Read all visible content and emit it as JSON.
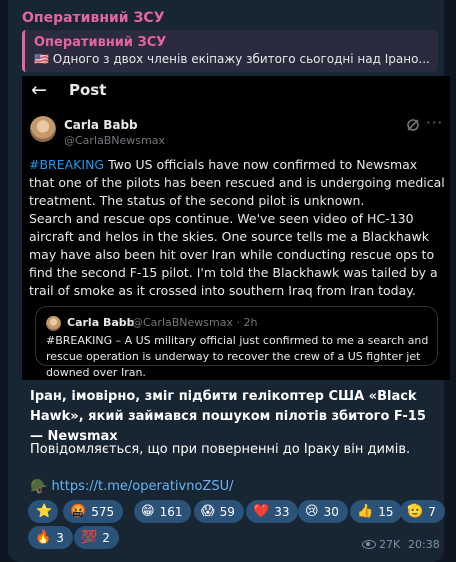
{
  "channel": {
    "name": "Оперативний ЗСУ"
  },
  "reply": {
    "title": "Оперативний ЗСУ",
    "flag": "🇺🇸",
    "text": "Одного з двох членів екіпажу збитого сьогодні над Ірано..."
  },
  "embedded_post": {
    "back_glyph": "←",
    "header": "Post",
    "author_name": "Carla Babb",
    "author_handle": "@CarlaBNewsmax",
    "more_glyph": "···",
    "hashtag": "#BREAKING",
    "text_after_hashtag": " Two US officials have now confirmed to Newsmax that one of the pilots has been rescued and is undergoing medical treatment. The status of the second pilot is unknown.",
    "text_paragraph_2": "Search and rescue ops continue. We've seen video of HC-130 aircraft and helos in the skies. One source tells me a Blackhawk may have also been hit over Iran while conducting rescue ops to find the second F-15 pilot. I'm told the Blackhawk was tailed by a trail of smoke as it crossed into southern Iraq from Iran today.",
    "quote": {
      "author_name": "Carla Babb",
      "meta": "@CarlaBNewsmax · 2h",
      "text": "#BREAKING – A US military official just confirmed to me a search and rescue operation is underway to recover the crew of a US fighter jet downed over Iran."
    }
  },
  "message": {
    "title": "Іран, імовірно, зміг підбити гелікоптер США «Black Hawk», який займався пошуком пілотів збитого F-15 — Newsmax",
    "body": "Повідомляється, що при поверненні до Іраку він димів.",
    "link_icon": "🪖",
    "link_text": "https://t.me/operativnoZSU/"
  },
  "reactions": [
    {
      "emoji": "⭐",
      "count": ""
    },
    {
      "emoji": "🤬",
      "count": "575"
    },
    {
      "emoji": "😁",
      "count": "161"
    },
    {
      "emoji": "😱",
      "count": "59"
    },
    {
      "emoji": "❤️",
      "count": "33"
    },
    {
      "emoji": "😢",
      "count": "30"
    },
    {
      "emoji": "👍",
      "count": "15"
    },
    {
      "emoji": "🫡",
      "count": "7"
    },
    {
      "emoji": "🔥",
      "count": "3"
    },
    {
      "emoji": "💯",
      "count": "2"
    }
  ],
  "footer": {
    "views": "27K",
    "time": "20:38"
  },
  "colors": {
    "background": "#0e1621",
    "bubble": "#182533",
    "accent": "#e4669e",
    "link": "#6ab3f3",
    "reaction_bg": "#2b5278",
    "hashtag": "#1d9bf0"
  }
}
